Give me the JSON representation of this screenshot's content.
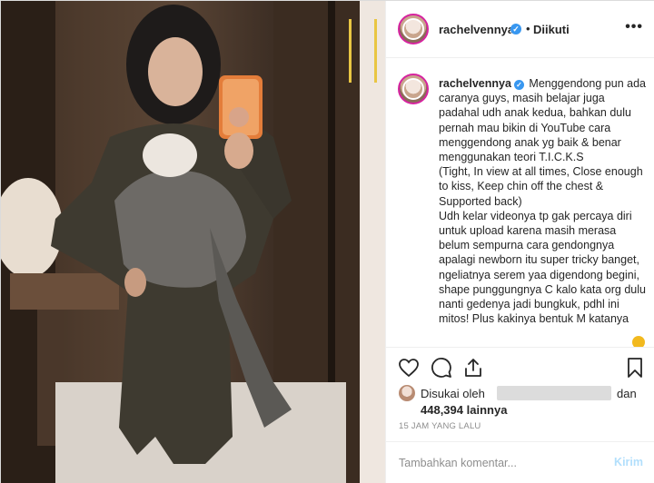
{
  "post": {
    "username": "rachelvennya",
    "separator": "•",
    "follow_state": "Diikuti",
    "more_icon": "more-horizontal-icon",
    "caption_user": "rachelvennya",
    "caption_text": "Menggendong pun ada caranya guys, masih belajar juga padahal udh anak kedua, bahkan dulu pernah mau bikin di YouTube cara menggendong anak yg baik & benar menggunakan teori T.I.C.K.S\n(Tight, In view at all times, Close enough to kiss, Keep chin off the chest & Supported back)\nUdh kelar videonya tp gak percaya diri untuk upload karena masih merasa belum sempurna cara gendongnya apalagi newborn itu super tricky banget, ngeliatnya serem yaa digendong begini, shape punggungnya C kalo kata org dulu nanti gedenya jadi bungkuk, pdhl ini mitos! Plus kakinya bentuk M katanya",
    "liked_by_prefix": "Disukai oleh",
    "liked_by_and": "dan",
    "like_count": "448,394",
    "like_count_suffix": "lainnya",
    "timestamp": "15 JAM YANG LALU",
    "comment_placeholder": "Tambahkan komentar...",
    "post_button": "Kirim"
  },
  "colors": {
    "verified": "#3897f0",
    "story_ring": "#d6249f",
    "post_button_disabled": "#b2dffc"
  }
}
